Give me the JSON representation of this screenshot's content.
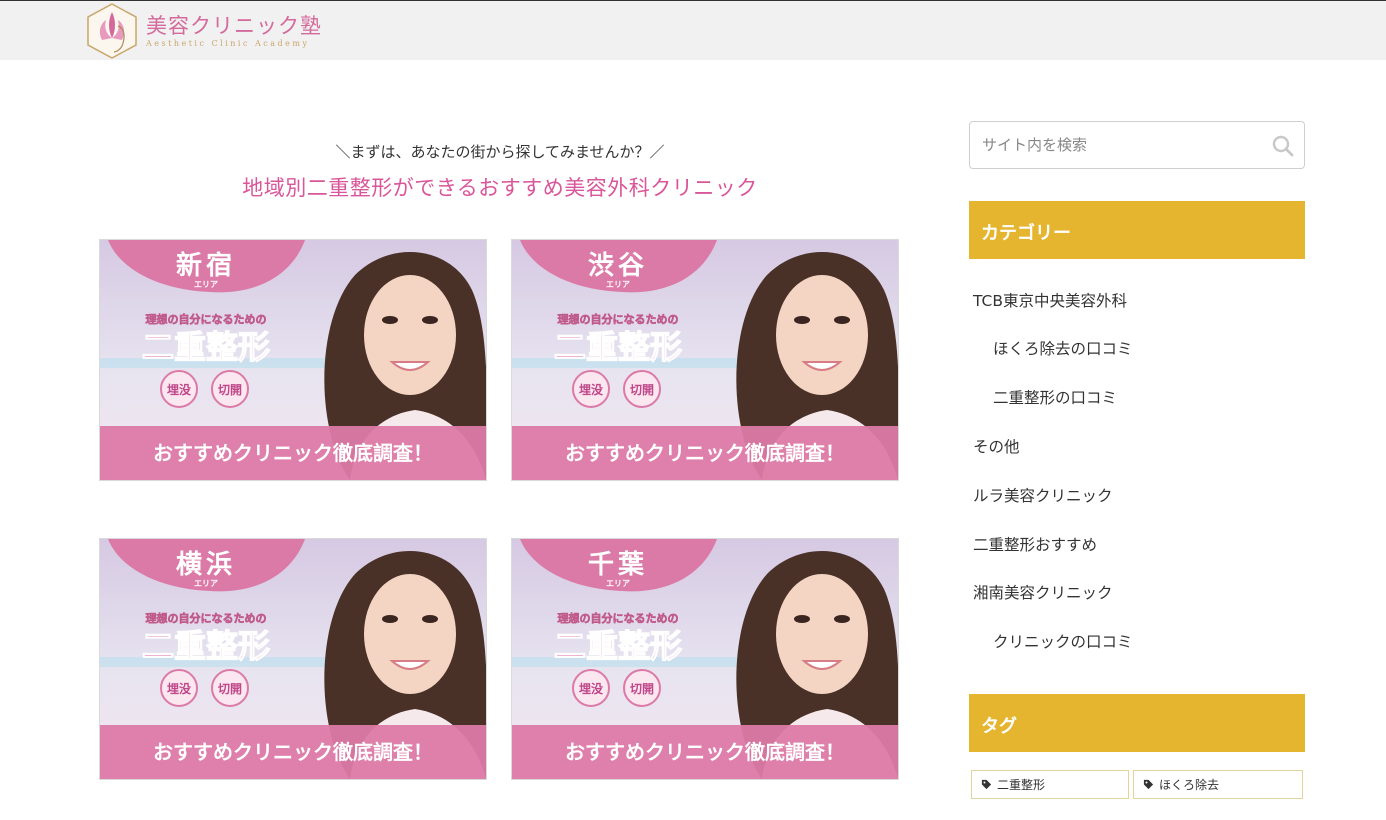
{
  "header": {
    "logo_title": "美容クリニック塾",
    "logo_subtitle": "Aesthetic Clinic Academy"
  },
  "main": {
    "lead": "＼まずは、あなたの街から探してみませんか？／",
    "headline": "地域別二重整形ができるおすすめ美容外科クリニック",
    "banners": [
      {
        "area": "新宿",
        "area_sub": "エリア",
        "tagline": "理想の自分になるための",
        "title": "二重整形",
        "badge1": "埋没",
        "badge2": "切開",
        "cta": "おすすめクリニック徹底調査！"
      },
      {
        "area": "渋谷",
        "area_sub": "エリア",
        "tagline": "理想の自分になるための",
        "title": "二重整形",
        "badge1": "埋没",
        "badge2": "切開",
        "cta": "おすすめクリニック徹底調査！"
      },
      {
        "area": "横浜",
        "area_sub": "エリア",
        "tagline": "理想の自分になるための",
        "title": "二重整形",
        "badge1": "埋没",
        "badge2": "切開",
        "cta": "おすすめクリニック徹底調査！"
      },
      {
        "area": "千葉",
        "area_sub": "エリア",
        "tagline": "理想の自分になるための",
        "title": "二重整形",
        "badge1": "埋没",
        "badge2": "切開",
        "cta": "おすすめクリニック徹底調査！"
      }
    ]
  },
  "sidebar": {
    "search": {
      "placeholder": "サイト内を検索",
      "icon": "search-icon"
    },
    "categories_title": "カテゴリー",
    "categories": [
      "TCB東京中央美容外科",
      "ほくろ除去の口コミ",
      "二重整形の口コミ",
      "その他",
      "ルラ美容クリニック",
      "二重整形おすすめ",
      "湘南美容クリニック",
      "クリニックの口コミ"
    ],
    "tags_title": "タグ",
    "tags": [
      "二重整形",
      "ほくろ除去"
    ]
  },
  "colors": {
    "accent_pink": "#d9569a",
    "widget_gold": "#e6b52f",
    "banner_pink": "#dc7aa7",
    "header_bg": "#f1f1f1"
  }
}
